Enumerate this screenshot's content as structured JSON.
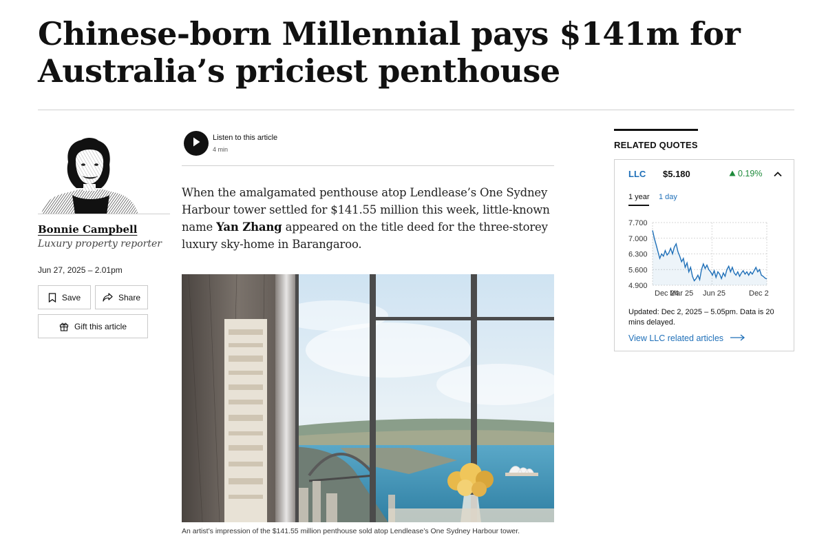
{
  "article": {
    "headline": "Chinese-born Millennial pays $141m for Australia’s priciest penthouse",
    "lede_part1": "When the amalgamated penthouse atop Lendlease’s One Sydney Harbour tower settled for $141.55 million this week, little-known name ",
    "lede_name": "Yan Zhang",
    "lede_part2": " appeared on the title deed for the three-storey luxury sky-home in Barangaroo.",
    "image_caption": "An artist’s impression of the $141.55 million penthouse sold atop Lendlease’s One Sydney Harbour tower."
  },
  "author": {
    "name": "Bonnie Campbell",
    "role": "Luxury property reporter",
    "published": "Jun 27, 2025 – 2.01pm"
  },
  "actions": {
    "save_label": "Save",
    "share_label": "Share",
    "gift_label": "Gift this article"
  },
  "listen": {
    "label": "Listen to this article",
    "duration": "4 min"
  },
  "related_quotes": {
    "title": "RELATED QUOTES",
    "ticker": "LLC",
    "price": "$5.180",
    "change": "0.19%",
    "change_direction": "up",
    "tabs": [
      {
        "label": "1 year",
        "active": true
      },
      {
        "label": "1 day",
        "active": false
      }
    ],
    "updated": "Updated: Dec 2, 2025 – 5.05pm. Data is 20 mins delayed.",
    "link_label": "View LLC related articles",
    "colors": {
      "link": "#1e6fb8",
      "up": "#1d8a3a",
      "line": "#1e6fb8"
    }
  },
  "chart_data": {
    "type": "line",
    "title": "",
    "xlabel": "",
    "ylabel": "",
    "y_ticks": [
      "7.700",
      "7.000",
      "6.300",
      "5.600",
      "4.900"
    ],
    "x_ticks": [
      "Dec 24",
      "Mar 25",
      "Jun 25",
      "Dec 2"
    ],
    "ylim": [
      4.9,
      7.7
    ],
    "grid": true,
    "series": [
      {
        "values": [
          7.35,
          7.0,
          6.7,
          6.4,
          6.1,
          6.3,
          6.2,
          6.45,
          6.25,
          6.35,
          6.55,
          6.3,
          6.6,
          6.75,
          6.4,
          6.2,
          5.95,
          6.1,
          5.7,
          5.9,
          5.5,
          5.7,
          5.3,
          5.1,
          5.2,
          5.35,
          5.15,
          5.6,
          5.85,
          5.65,
          5.8,
          5.6,
          5.5,
          5.35,
          5.55,
          5.25,
          5.5,
          5.4,
          5.2,
          5.45,
          5.3,
          5.6,
          5.75,
          5.5,
          5.7,
          5.45,
          5.35,
          5.5,
          5.3,
          5.45,
          5.55,
          5.4,
          5.5,
          5.35,
          5.5,
          5.4,
          5.55,
          5.7,
          5.5,
          5.6,
          5.35,
          5.3,
          5.22,
          5.18
        ]
      }
    ]
  }
}
